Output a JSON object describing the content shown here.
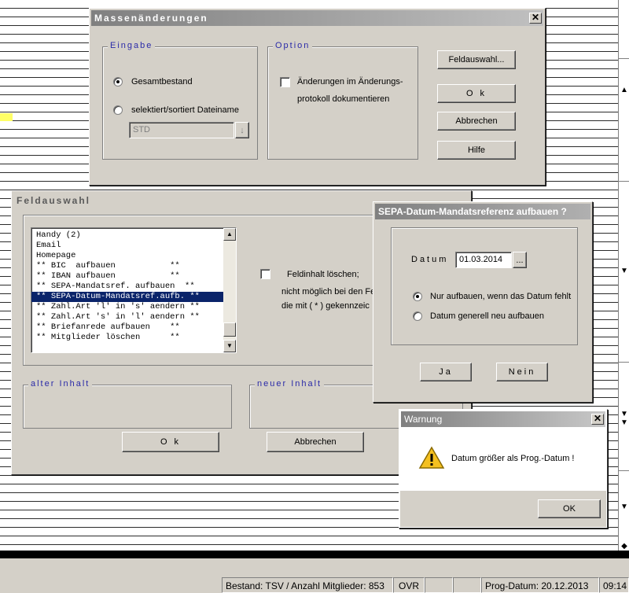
{
  "massen": {
    "title": "Massenänderungen",
    "close": "✕",
    "eingabe_title": "Eingabe",
    "option_title": "Option",
    "radio_gesamt": "Gesamtbestand",
    "radio_selekt": "selektiert/sortiert Dateiname",
    "dateiname_value": "STD",
    "dropdown_arrow": "↓",
    "option_line1": "Änderungen im Änderungs-",
    "option_line2": "protokoll dokumentieren",
    "btn_feldauswahl": "Feldauswahl...",
    "btn_ok": "O k",
    "btn_abbrechen": "Abbrechen",
    "btn_hilfe": "Hilfe"
  },
  "feld": {
    "title": "Feldauswahl",
    "list_items": [
      "Handy (2)",
      "Email",
      "Homepage",
      "** BIC  aufbauen           **",
      "** IBAN aufbauen           **",
      "** SEPA-Mandatsref. aufbauen  **",
      "** SEPA-Datum-Mandatsref.aufb. **",
      "** Zahl.Art 'l' in 's' aendern **",
      "** Zahl.Art 's' in 'l' aendern **",
      "** Briefanrede aufbauen    **",
      "** Mitglieder löschen      **"
    ],
    "selected_index": 6,
    "feldinhalt_label": "Feldinhalt löschen;",
    "hint_line1": "nicht möglich bei den Fe",
    "hint_line2": "die mit  ( * )  gekennzeic",
    "alter_title": "alter Inhalt",
    "neuer_title": "neuer Inhalt",
    "btn_ok": "O k",
    "btn_abbrechen": "Abbrechen"
  },
  "sepa": {
    "title": "SEPA-Datum-Mandatsreferenz aufbauen ?",
    "datum_label": "Datum",
    "datum_value": "01.03.2014",
    "ellipsis": "...",
    "radio_nur": "Nur aufbauen, wenn das Datum fehlt",
    "radio_generell": "Datum generell neu aufbauen",
    "btn_ja": "Ja",
    "btn_nein": "Nein"
  },
  "warn": {
    "title": "Warnung",
    "close": "✕",
    "message": "Datum größer als Prog.-Datum !",
    "btn_ok": "OK"
  },
  "status": {
    "bestand": "Bestand: TSV / Anzahl Mitglieder: 853",
    "ovr": "OVR",
    "empty1": "",
    "empty2": "",
    "prog_datum": "Prog-Datum: 20.12.2013",
    "time": "09:14"
  },
  "scroll": {
    "up": "▲",
    "down": "▼",
    "down2": "▼",
    "down3": "▼",
    "down4": "▼",
    "updown": "◆"
  },
  "colors": {
    "selection": "#0a246a",
    "group_title": "#2a2aa8",
    "dialog_bg": "#d4d0c8"
  }
}
